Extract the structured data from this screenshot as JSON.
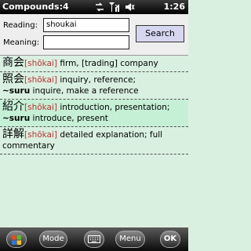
{
  "status_bar": {
    "title": "Compounds:4",
    "time": "1:26",
    "icons": [
      "connection-icon",
      "signal-icon",
      "volume-icon"
    ]
  },
  "search": {
    "reading_label": "Reading:",
    "reading_value": "shoukai",
    "meaning_label": "Meaning:",
    "meaning_value": "",
    "button_label": "Search"
  },
  "results": [
    {
      "kanji": "商会",
      "reading": "[shōkai]",
      "text": " firm, [trading] company"
    },
    {
      "kanji": "照会",
      "reading": "[shōkai]",
      "text": " inquiry, reference;",
      "suru": "~suru",
      "suru_text": " inquire, make a reference"
    },
    {
      "kanji": "紹介",
      "reading": "[shōkai]",
      "text": " introduction, presentation;",
      "suru": "~suru",
      "suru_text": " introduce, present"
    },
    {
      "kanji": "詳解",
      "reading": "[shōkai]",
      "text": " detailed explanation; full commentary"
    }
  ],
  "softkeys": {
    "start_icon": "windows-start-icon",
    "mode_label": "Mode",
    "keyboard_icon": "keyboard-icon",
    "menu_label": "Menu",
    "ok_label": "OK"
  }
}
